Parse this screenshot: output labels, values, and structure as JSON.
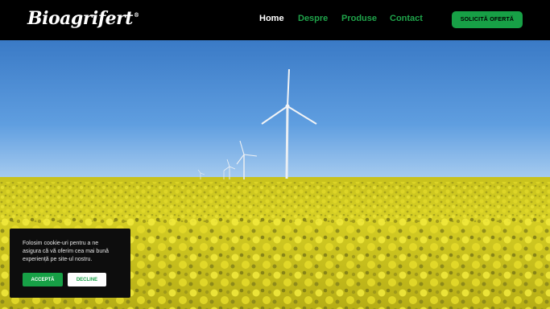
{
  "brand": {
    "name": "Bioagrifert",
    "registered": "®"
  },
  "nav": {
    "items": [
      {
        "label": "Home"
      },
      {
        "label": "Despre"
      },
      {
        "label": "Produse"
      },
      {
        "label": "Contact"
      }
    ],
    "cta_label": "SOLICITĂ OFERTĂ"
  },
  "hero": {
    "image": "wind-turbines-rapeseed-field"
  },
  "cookie_banner": {
    "text": "Folosim cookie-uri pentru a ne asigura că vă oferim cea mai bună experiență pe site-ul nostru.",
    "accept_label": "ACCEPTĂ",
    "decline_label": "DECLINE"
  },
  "colors": {
    "accent": "#17a046",
    "header_bg": "#000000",
    "sky_top": "#3e7fc9",
    "field": "#d9d21e"
  }
}
